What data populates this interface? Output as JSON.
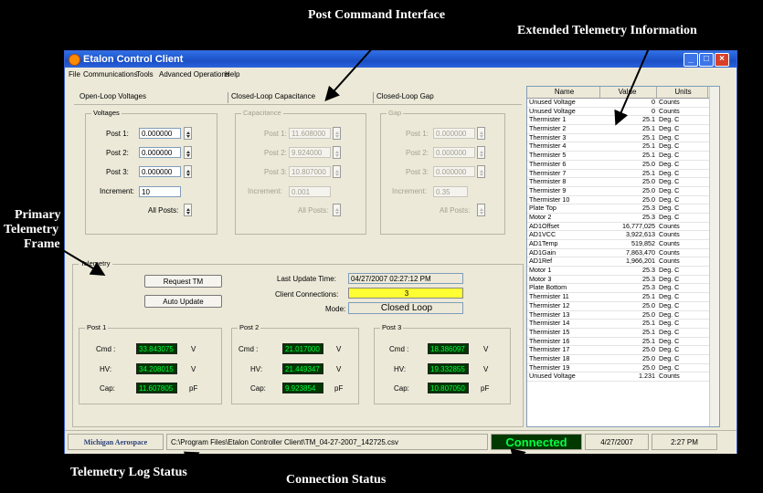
{
  "annotations": {
    "post_command": "Post Command Interface",
    "extended_tm": "Extended Telemetry Information",
    "primary_line1": "Primary",
    "primary_line2": "Telemetry",
    "primary_line3": "Frame",
    "log_status": "Telemetry Log Status",
    "connection_status": "Connection Status"
  },
  "window": {
    "title": "Etalon Control Client"
  },
  "menu": [
    "File",
    "Communications",
    "Tools",
    "Advanced Operations",
    "Help"
  ],
  "tabs": [
    "Open-Loop Voltages",
    "Closed-Loop Capacitance",
    "Closed-Loop Gap"
  ],
  "voltages": {
    "group": "Voltages",
    "post1_label": "Post 1:",
    "post1_value": "0.000000",
    "post2_label": "Post 2:",
    "post2_value": "0.000000",
    "post3_label": "Post 3:",
    "post3_value": "0.000000",
    "increment_label": "Increment:",
    "increment_value": "10",
    "all_posts_label": "All Posts:"
  },
  "capacitance": {
    "group": "Capacitance",
    "post1_label": "Post 1:",
    "post1_value": "11.608000",
    "post2_label": "Post 2:",
    "post2_value": "9.924000",
    "post3_label": "Post 3:",
    "post3_value": "10.807000",
    "increment_label": "Increment:",
    "increment_value": "0.001",
    "all_posts_label": "All Posts:"
  },
  "gap": {
    "group": "Gap",
    "post1_label": "Post 1:",
    "post1_value": "0.000000",
    "post2_label": "Post 2:",
    "post2_value": "0.000000",
    "post3_label": "Post 3:",
    "post3_value": "0.000000",
    "increment_label": "Increment:",
    "increment_value": "0.35",
    "all_posts_label": "All Posts:"
  },
  "telemetry": {
    "group": "Telemetry",
    "request_button": "Request TM",
    "auto_button": "Auto Update",
    "last_update_label": "Last Update Time:",
    "last_update_value": "04/27/2007  02:27:12 PM",
    "client_conn_label": "Client Connections:",
    "client_conn_value": "3",
    "mode_label": "Mode:",
    "mode_value": "Closed Loop"
  },
  "posts": [
    {
      "title": "Post 1",
      "cmd_label": "Cmd :",
      "cmd": "33.843075",
      "cmd_unit": "V",
      "hv_label": "HV:",
      "hv": "34.208015",
      "hv_unit": "V",
      "cap_label": "Cap:",
      "cap": "11.607805",
      "cap_unit": "pF"
    },
    {
      "title": "Post 2",
      "cmd_label": "Cmd :",
      "cmd": "21.017000",
      "cmd_unit": "V",
      "hv_label": "HV:",
      "hv": "21.449347",
      "hv_unit": "V",
      "cap_label": "Cap:",
      "cap": "9.923854",
      "cap_unit": "pF"
    },
    {
      "title": "Post 3",
      "cmd_label": "Cmd :",
      "cmd": "18.386097",
      "cmd_unit": "V",
      "hv_label": "HV:",
      "hv": "19.332855",
      "hv_unit": "V",
      "cap_label": "Cap:",
      "cap": "10.807050",
      "cap_unit": "pF"
    }
  ],
  "grid": {
    "headers": [
      "Name",
      "Value",
      "Units"
    ],
    "rows": [
      [
        "Unused Voltage",
        "0",
        "Counts"
      ],
      [
        "Unused Voltage",
        "0",
        "Counts"
      ],
      [
        "Thermister 1",
        "25.1",
        "Deg. C"
      ],
      [
        "Thermister 2",
        "25.1",
        "Deg. C"
      ],
      [
        "Thermister 3",
        "25.1",
        "Deg. C"
      ],
      [
        "Thermister 4",
        "25.1",
        "Deg. C"
      ],
      [
        "Thermister 5",
        "25.1",
        "Deg. C"
      ],
      [
        "Thermister 6",
        "25.0",
        "Deg. C"
      ],
      [
        "Thermister 7",
        "25.1",
        "Deg. C"
      ],
      [
        "Thermister 8",
        "25.0",
        "Deg. C"
      ],
      [
        "Thermister 9",
        "25.0",
        "Deg. C"
      ],
      [
        "Thermister 10",
        "25.0",
        "Deg. C"
      ],
      [
        "Plate Top",
        "25.3",
        "Deg. C"
      ],
      [
        "Motor 2",
        "25.3",
        "Deg. C"
      ],
      [
        "AD1Offset",
        "16,777,025",
        "Counts"
      ],
      [
        "AD1VCC",
        "3,922,613",
        "Counts"
      ],
      [
        "AD1Temp",
        "519,852",
        "Counts"
      ],
      [
        "AD1Gain",
        "7,863,470",
        "Counts"
      ],
      [
        "AD1Ref",
        "1,966,201",
        "Counts"
      ],
      [
        "Motor 1",
        "25.3",
        "Deg. C"
      ],
      [
        "Motor 3",
        "25.3",
        "Deg. C"
      ],
      [
        "Plate Bottom",
        "25.3",
        "Deg. C"
      ],
      [
        "Thermister 11",
        "25.1",
        "Deg. C"
      ],
      [
        "Thermister 12",
        "25.0",
        "Deg. C"
      ],
      [
        "Thermister 13",
        "25.0",
        "Deg. C"
      ],
      [
        "Thermister 14",
        "25.1",
        "Deg. C"
      ],
      [
        "Thermister 15",
        "25.1",
        "Deg. C"
      ],
      [
        "Thermister 16",
        "25.1",
        "Deg. C"
      ],
      [
        "Thermister 17",
        "25.0",
        "Deg. C"
      ],
      [
        "Thermister 18",
        "25.0",
        "Deg. C"
      ],
      [
        "Thermister 19",
        "25.0",
        "Deg. C"
      ],
      [
        "Unused Voltage",
        "1.231",
        "Counts"
      ]
    ]
  },
  "statusbar": {
    "logo": "Michigan Aerospace",
    "log_path": "C:\\Program Files\\Etalon Controller Client\\TM_04-27-2007_142725.csv",
    "connection": "Connected",
    "date": "4/27/2007",
    "time": "2:27 PM"
  },
  "colors": {
    "connected_bg": "#003800",
    "connected_fg": "#00ff44",
    "client_conn_bg": "#ffff33",
    "titlebar": "#1b4fc4"
  }
}
